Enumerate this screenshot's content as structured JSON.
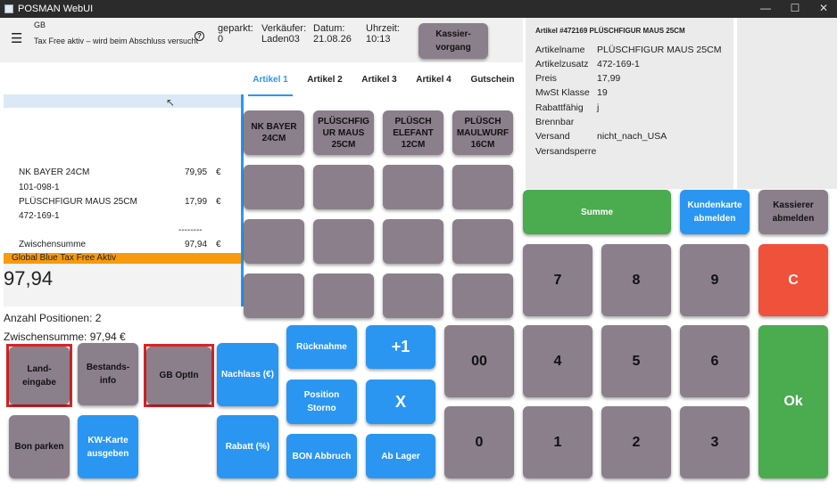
{
  "window": {
    "title": "POSMAN WebUI",
    "min": "—",
    "max": "☐",
    "close": "✕"
  },
  "header": {
    "country": "GB",
    "taxfree_note": "Tax Free aktiv – wird beim Abschluss versucht",
    "geparkt_label": "geparkt:",
    "geparkt_value": "0",
    "verkaeufer_label": "Verkäufer:",
    "verkaeufer_value": "Laden03",
    "datum_label": "Datum:",
    "datum_value": "21.08.26",
    "uhrzeit_label": "Uhrzeit:",
    "uhrzeit_value": "10:13",
    "kassiervorgang_label_1": "Kassier-",
    "kassiervorgang_label_2": "vorgang"
  },
  "article_info": {
    "heading": "Artikel #472169 PLÜSCHFIGUR MAUS 25CM",
    "rows": [
      {
        "label": "Artikelname",
        "value": "PLÜSCHFIGUR MAUS 25CM"
      },
      {
        "label": "Artikelzusatz",
        "value": "472-169-1"
      },
      {
        "label": "Preis",
        "value": "17,99"
      },
      {
        "label": "MwSt Klasse",
        "value": "19"
      },
      {
        "label": "Rabattfähig",
        "value": "j"
      },
      {
        "label": "Brennbar",
        "value": ""
      },
      {
        "label": "Versand",
        "value": "nicht_nach_USA"
      },
      {
        "label": "Versandsperre",
        "value": ""
      }
    ]
  },
  "receipt": {
    "items": [
      {
        "name": "NK BAYER 24CM",
        "code": "101-098-1",
        "price": "79,95",
        "cur": "€"
      },
      {
        "name": "PLÜSCHFIGUR MAUS 25CM",
        "code": "472-169-1",
        "price": "17,99",
        "cur": "€"
      }
    ],
    "divider": "--------",
    "subtotal_label": "Zwischensumme",
    "subtotal_value": "97,94",
    "subtotal_cur": "€",
    "taxfree_banner": "Global Blue Tax Free Aktiv",
    "total": "97,94",
    "positions": "Anzahl Positionen: 2",
    "zwischensumme": "Zwischensumme: 97,94 €"
  },
  "tabs": [
    "Artikel 1",
    "Artikel 2",
    "Artikel 3",
    "Artikel 4",
    "Gutschein"
  ],
  "article_buttons": [
    {
      "l1": "NK BAYER",
      "l2": "24CM",
      "l3": ""
    },
    {
      "l1": "PLÜSCHFIG",
      "l2": "UR MAUS",
      "l3": "25CM"
    },
    {
      "l1": "PLÜSCH",
      "l2": "ELEFANT",
      "l3": "12CM"
    },
    {
      "l1": "PLÜSCH",
      "l2": "MAULWURF",
      "l3": "16CM"
    }
  ],
  "buttons": {
    "land_1": "Land-",
    "land_2": "eingabe",
    "bestand_1": "Bestands-",
    "bestand_2": "info",
    "gboptin": "GB OptIn",
    "nachlass": "Nachlass (€)",
    "ruecknahme": "Rücknahme",
    "plus1": "+1",
    "bon_parken": "Bon parken",
    "kw_1": "KW-Karte",
    "kw_2": "ausgeben",
    "rabatt": "Rabatt (%)",
    "pos_storno_1": "Position",
    "pos_storno_2": "Storno",
    "x": "X",
    "bon_abbruch": "BON Abbruch",
    "ab_lager": "Ab Lager",
    "summe": "Summe",
    "kunde_1": "Kundenkarte",
    "kunde_2": "abmelden",
    "kassierer_1": "Kassierer",
    "kassierer_2": "abmelden",
    "c": "C",
    "ok": "Ok"
  },
  "numpad": {
    "n7": "7",
    "n8": "8",
    "n9": "9",
    "n4": "4",
    "n5": "5",
    "n6": "6",
    "n1": "1",
    "n2": "2",
    "n3": "3",
    "n0": "0",
    "n00": "00"
  },
  "colors": {
    "button_gray": "#8a7f8b",
    "button_blue": "#2a96f2",
    "button_green": "#4bab4f",
    "button_red": "#f0513b",
    "banner_orange": "#f89a0e",
    "highlight_frame": "#d92528"
  }
}
